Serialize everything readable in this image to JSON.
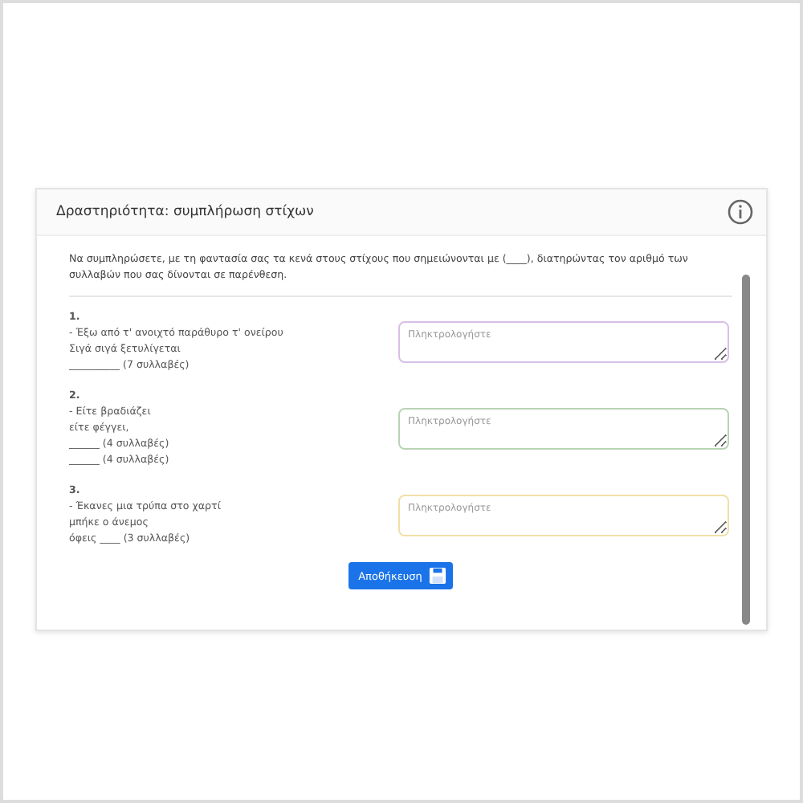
{
  "card": {
    "title": "Δραστηριότητα: συμπλήρωση στίχων"
  },
  "instructions": "Να συμπληρώσετε, με τη φαντασία σας τα κενά στους στίχους που σημειώνονται με (____), διατηρώντας τον αριθμό των συλλαβών που σας δίνονται σε παρένθεση.",
  "exercises": [
    {
      "number": "1.",
      "lines": [
        "- Έξω από τ' ανοιχτό παράθυρο τ' ονείρου",
        "Σιγά σιγά ξετυλίγεται",
        "__________ (7 συλλαβές)"
      ],
      "placeholder": "Πληκτρολογήστε",
      "color": "#d9bfe6"
    },
    {
      "number": "2.",
      "lines": [
        "- Είτε βραδιάζει",
        "είτε φέγγει,",
        "______ (4 συλλαβές)",
        "______ (4 συλλαβές)"
      ],
      "placeholder": "Πληκτρολογήστε",
      "color": "#b9d4b4"
    },
    {
      "number": "3.",
      "lines": [
        "- Έκανες μια τρύπα στο χαρτί",
        "μπήκε ο άνεμος",
        "όφεις ____ (3 συλλαβές)"
      ],
      "placeholder": "Πληκτρολογήστε",
      "color": "#f0dfa8"
    }
  ],
  "save_button": {
    "label": "Αποθήκευση"
  }
}
